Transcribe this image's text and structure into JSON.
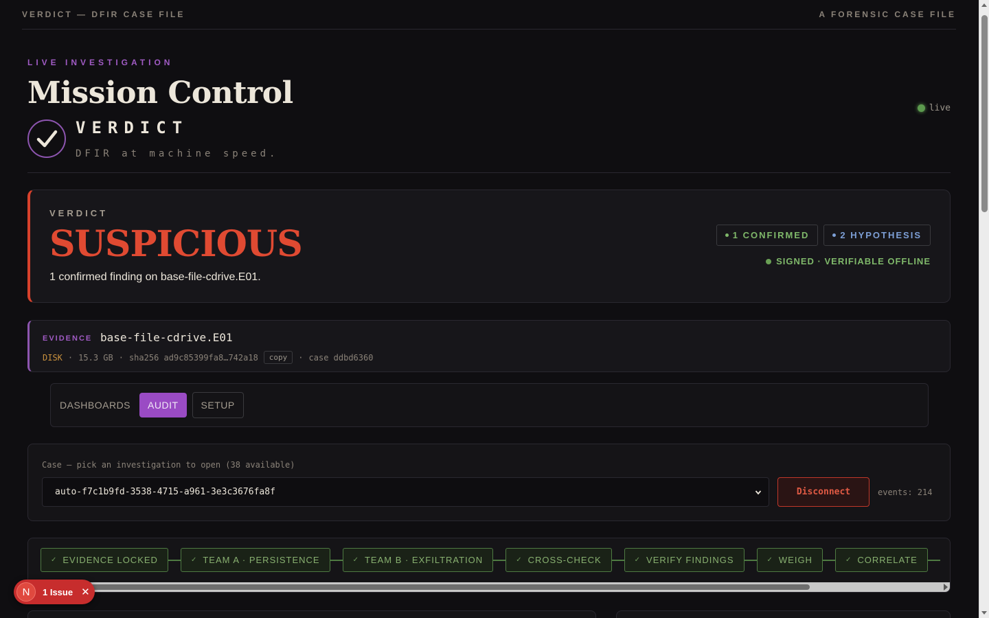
{
  "topbar": {
    "left": "VERDICT — DFIR CASE FILE",
    "right": "A FORENSIC CASE FILE"
  },
  "header": {
    "eyebrow": "LIVE INVESTIGATION",
    "title": "Mission Control",
    "brand": "VERDICT",
    "tagline": "DFIR at machine speed.",
    "status": "live"
  },
  "verdict": {
    "label": "VERDICT",
    "word": "SUSPICIOUS",
    "summary": "1 confirmed finding on base-file-cdrive.E01.",
    "confirmed": "1 CONFIRMED",
    "hypothesis": "2 HYPOTHESIS",
    "signed": "SIGNED · VERIFIABLE OFFLINE"
  },
  "evidence": {
    "label": "EVIDENCE",
    "name": "base-file-cdrive.E01",
    "type": "DISK",
    "size": "15.3 GB",
    "hash": "sha256 ad9c85399fa8…742a18",
    "copy": "copy",
    "case": "case ddbd6360",
    "sep": "·"
  },
  "tabs": [
    {
      "label": "DASHBOARDS",
      "state": "plain"
    },
    {
      "label": "AUDIT",
      "state": "active"
    },
    {
      "label": "SETUP",
      "state": "outline"
    }
  ],
  "case": {
    "label": "Case — pick an investigation to open (38 available)",
    "selected": "auto-f7c1b9fd-3538-4715-a961-3e3c3676fa8f",
    "disconnect": "Disconnect",
    "events": "events: 214"
  },
  "pipeline": {
    "steps": [
      "EVIDENCE LOCKED",
      "TEAM A · PERSISTENCE",
      "TEAM B · EXFILTRATION",
      "CROSS-CHECK",
      "VERIFY FINDINGS",
      "WEIGH",
      "CORRELATE"
    ]
  },
  "issue": {
    "badge": "N",
    "label": "1 Issue"
  },
  "colors": {
    "accent": "#9a4bc4",
    "danger": "#e04a32",
    "ok": "#7fb86a",
    "info": "#7d9fd6",
    "disk": "#c9913e"
  }
}
